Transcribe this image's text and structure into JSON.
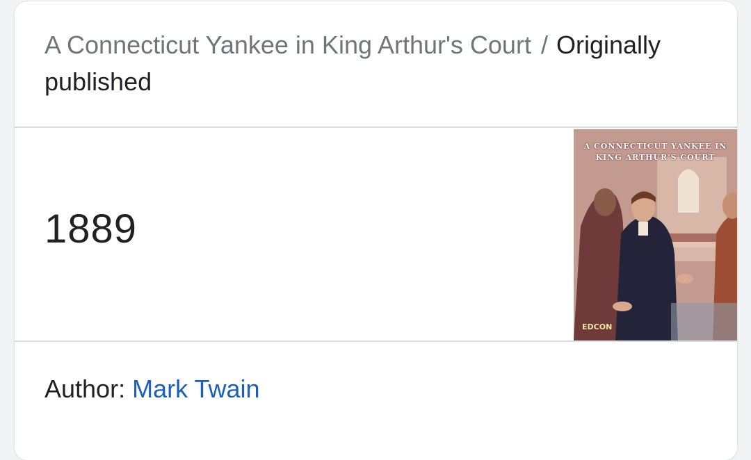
{
  "breadcrumb": {
    "book_title": "A Connecticut Yankee in King Arthur's Court",
    "separator": "/",
    "attribute": "Originally published"
  },
  "answer": {
    "value": "1889"
  },
  "cover": {
    "title_line1": "A CONNECTICUT YANKEE IN",
    "title_line2": "KING ARTHUR'S COURT",
    "publisher": "EDCON"
  },
  "author": {
    "label": "Author:",
    "name": "Mark Twain"
  },
  "colors": {
    "link": "#1a5fbd",
    "muted": "#70757a",
    "text": "#202124",
    "divider": "#dadce0"
  }
}
